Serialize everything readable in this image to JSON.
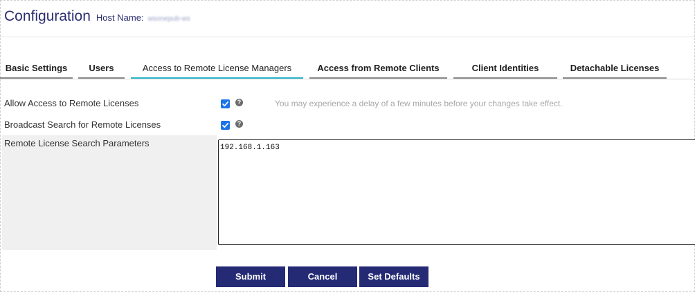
{
  "header": {
    "title": "Configuration",
    "host_label": "Host Name:",
    "host_value": "wsonepub-ws"
  },
  "tabs": [
    {
      "label": "Basic Settings",
      "active": false
    },
    {
      "label": "Users",
      "active": false
    },
    {
      "label": "Access to Remote License Managers",
      "active": true
    },
    {
      "label": "Access from Remote Clients",
      "active": false
    },
    {
      "label": "Client Identities",
      "active": false
    },
    {
      "label": "Detachable Licenses",
      "active": false
    }
  ],
  "form": {
    "allow_access_label": "Allow Access to Remote Licenses",
    "allow_access_checked": true,
    "broadcast_label": "Broadcast Search for Remote Licenses",
    "broadcast_checked": true,
    "help_glyph": "?",
    "delay_note": "You may experience a delay of a few minutes before your changes take effect.",
    "search_params_label": "Remote License Search Parameters",
    "search_params_value": "192.168.1.163"
  },
  "buttons": {
    "submit": "Submit",
    "cancel": "Cancel",
    "set_defaults": "Set Defaults"
  },
  "colors": {
    "title": "#2b2e6f",
    "active_tab_underline": "#2bb3c8",
    "button_bg": "#252a75",
    "checkbox": "#1a73e8"
  }
}
